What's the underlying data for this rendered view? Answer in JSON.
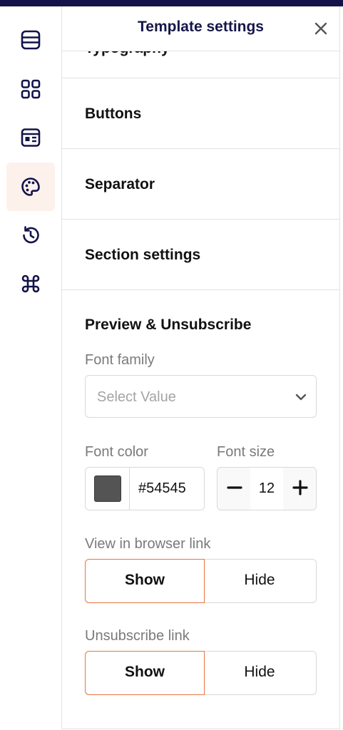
{
  "sidebar": {
    "items": [
      {
        "name": "layout",
        "icon": "rows-icon"
      },
      {
        "name": "blocks",
        "icon": "grid-icon"
      },
      {
        "name": "templates",
        "icon": "template-icon"
      },
      {
        "name": "styles",
        "icon": "palette-icon",
        "active": true
      },
      {
        "name": "history",
        "icon": "history-icon"
      },
      {
        "name": "shortcuts",
        "icon": "command-icon"
      }
    ]
  },
  "panel": {
    "title": "Template settings",
    "clipped_section": "Typography",
    "sections": [
      "Buttons",
      "Separator",
      "Section settings"
    ],
    "preview_section": {
      "title": "Preview & Unsubscribe",
      "font_family": {
        "label": "Font family",
        "placeholder": "Select Value"
      },
      "font_color": {
        "label": "Font color",
        "value": "#54545",
        "swatch": "#545454"
      },
      "font_size": {
        "label": "Font size",
        "value": "12"
      },
      "view_in_browser": {
        "label": "View in browser link",
        "show": "Show",
        "hide": "Hide",
        "selected": "Show"
      },
      "unsubscribe": {
        "label": "Unsubscribe link",
        "show": "Show",
        "hide": "Hide",
        "selected": "Show"
      }
    }
  },
  "colors": {
    "accent": "#e8763f",
    "navy": "#16164a",
    "icon": "#13134a"
  }
}
